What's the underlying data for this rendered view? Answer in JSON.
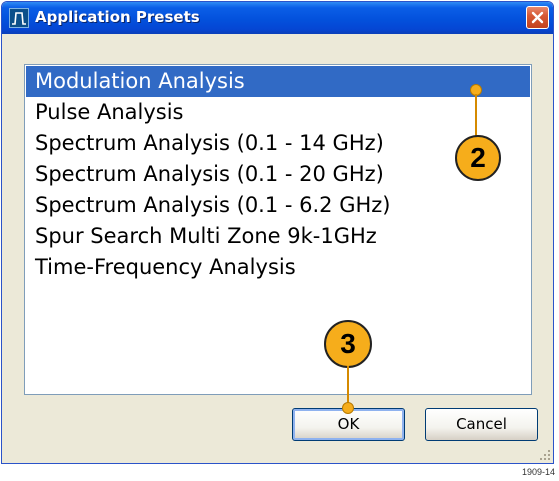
{
  "window": {
    "title": "Application Presets"
  },
  "presets": {
    "items": [
      {
        "label": "Modulation Analysis",
        "selected": true
      },
      {
        "label": "Pulse Analysis",
        "selected": false
      },
      {
        "label": "Spectrum Analysis (0.1 - 14 GHz)",
        "selected": false
      },
      {
        "label": "Spectrum Analysis (0.1 - 20 GHz)",
        "selected": false
      },
      {
        "label": "Spectrum Analysis (0.1 - 6.2 GHz)",
        "selected": false
      },
      {
        "label": "Spur Search Multi Zone 9k-1GHz",
        "selected": false
      },
      {
        "label": "Time-Frequency Analysis",
        "selected": false
      }
    ]
  },
  "buttons": {
    "ok_label": "OK",
    "cancel_label": "Cancel"
  },
  "callouts": {
    "selection_number": "2",
    "ok_number": "3"
  },
  "figure_id": "1909-14",
  "colors": {
    "titlebar": "#0351dc",
    "selection": "#316ac5",
    "callout": "#f6ad1b",
    "close": "#d75a36"
  }
}
